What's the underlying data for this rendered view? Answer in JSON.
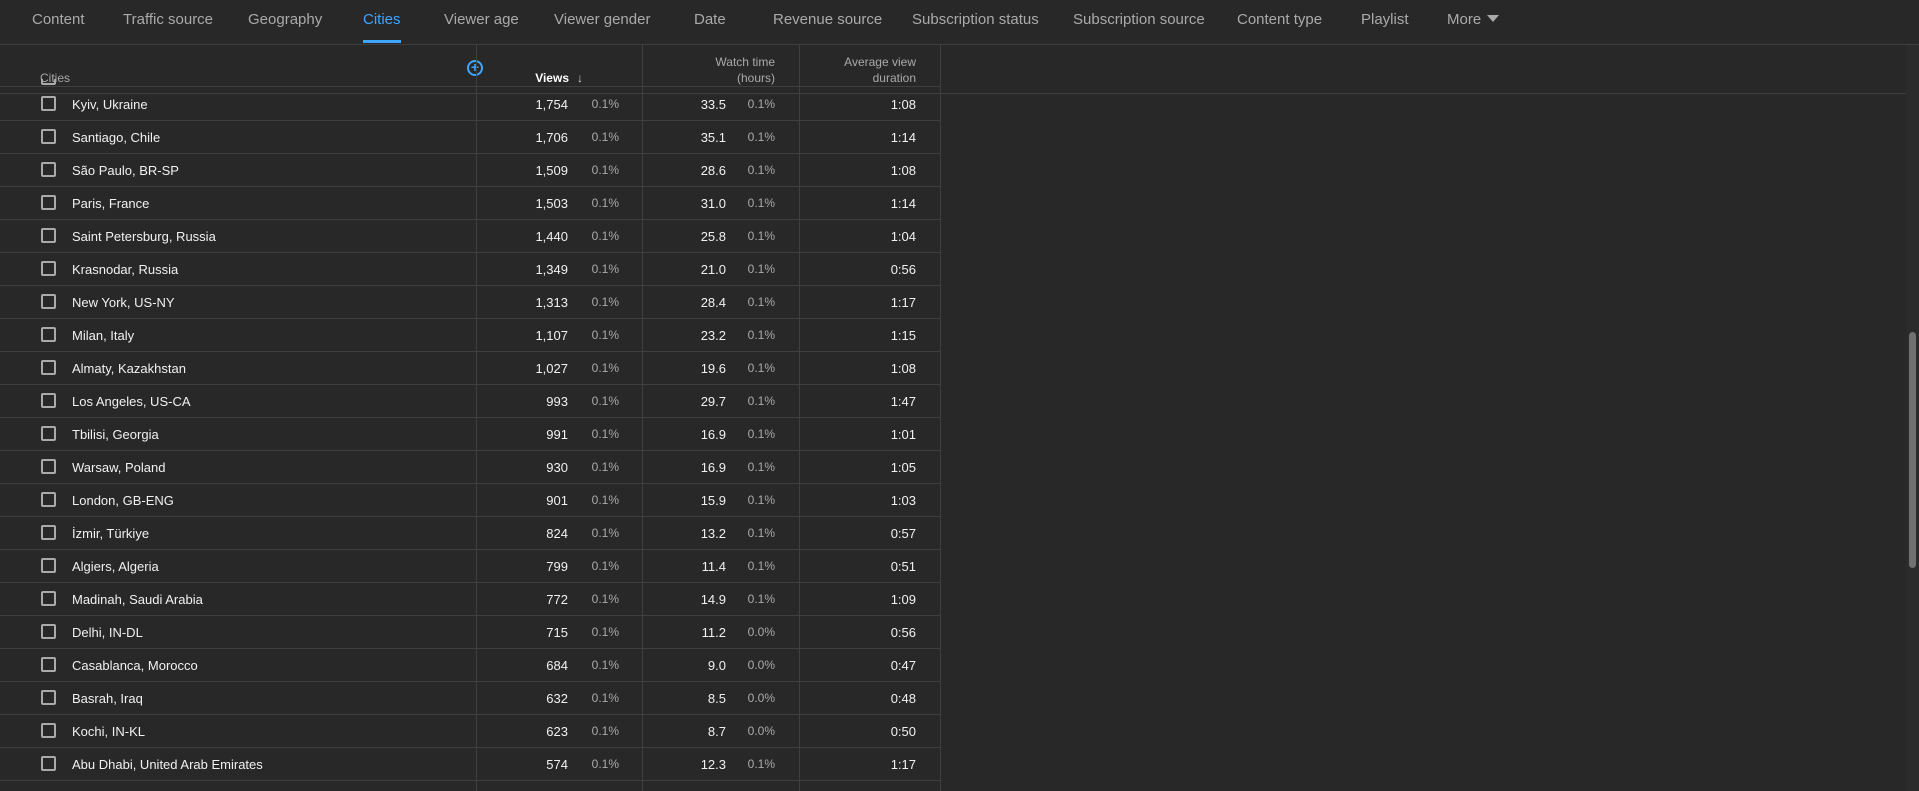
{
  "tabs": [
    {
      "label": "Content",
      "active": false
    },
    {
      "label": "Traffic source",
      "active": false
    },
    {
      "label": "Geography",
      "active": false
    },
    {
      "label": "Cities",
      "active": true
    },
    {
      "label": "Viewer age",
      "active": false
    },
    {
      "label": "Viewer gender",
      "active": false
    },
    {
      "label": "Date",
      "active": false
    },
    {
      "label": "Revenue source",
      "active": false
    },
    {
      "label": "Subscription status",
      "active": false
    },
    {
      "label": "Subscription source",
      "active": false
    },
    {
      "label": "Content type",
      "active": false
    },
    {
      "label": "Playlist",
      "active": false
    },
    {
      "label": "More",
      "active": false
    }
  ],
  "table": {
    "headers": {
      "cities": "Cities",
      "views": "Views",
      "views_sort_arrow": "↓",
      "watch_time_line1": "Watch time",
      "watch_time_line2": "(hours)",
      "avd_line1": "Average view",
      "avd_line2": "duration",
      "add_column_icon": "+"
    },
    "rows": [
      {
        "city": "Kyiv, Ukraine",
        "views": "1,754",
        "views_pct": "0.1%",
        "watch": "33.5",
        "watch_pct": "0.1%",
        "avd": "1:08"
      },
      {
        "city": "Santiago, Chile",
        "views": "1,706",
        "views_pct": "0.1%",
        "watch": "35.1",
        "watch_pct": "0.1%",
        "avd": "1:14"
      },
      {
        "city": "São Paulo, BR-SP",
        "views": "1,509",
        "views_pct": "0.1%",
        "watch": "28.6",
        "watch_pct": "0.1%",
        "avd": "1:08"
      },
      {
        "city": "Paris, France",
        "views": "1,503",
        "views_pct": "0.1%",
        "watch": "31.0",
        "watch_pct": "0.1%",
        "avd": "1:14"
      },
      {
        "city": "Saint Petersburg, Russia",
        "views": "1,440",
        "views_pct": "0.1%",
        "watch": "25.8",
        "watch_pct": "0.1%",
        "avd": "1:04"
      },
      {
        "city": "Krasnodar, Russia",
        "views": "1,349",
        "views_pct": "0.1%",
        "watch": "21.0",
        "watch_pct": "0.1%",
        "avd": "0:56"
      },
      {
        "city": "New York, US-NY",
        "views": "1,313",
        "views_pct": "0.1%",
        "watch": "28.4",
        "watch_pct": "0.1%",
        "avd": "1:17"
      },
      {
        "city": "Milan, Italy",
        "views": "1,107",
        "views_pct": "0.1%",
        "watch": "23.2",
        "watch_pct": "0.1%",
        "avd": "1:15"
      },
      {
        "city": "Almaty, Kazakhstan",
        "views": "1,027",
        "views_pct": "0.1%",
        "watch": "19.6",
        "watch_pct": "0.1%",
        "avd": "1:08"
      },
      {
        "city": "Los Angeles, US-CA",
        "views": "993",
        "views_pct": "0.1%",
        "watch": "29.7",
        "watch_pct": "0.1%",
        "avd": "1:47"
      },
      {
        "city": "Tbilisi, Georgia",
        "views": "991",
        "views_pct": "0.1%",
        "watch": "16.9",
        "watch_pct": "0.1%",
        "avd": "1:01"
      },
      {
        "city": "Warsaw, Poland",
        "views": "930",
        "views_pct": "0.1%",
        "watch": "16.9",
        "watch_pct": "0.1%",
        "avd": "1:05"
      },
      {
        "city": "London, GB-ENG",
        "views": "901",
        "views_pct": "0.1%",
        "watch": "15.9",
        "watch_pct": "0.1%",
        "avd": "1:03"
      },
      {
        "city": "İzmir, Türkiye",
        "views": "824",
        "views_pct": "0.1%",
        "watch": "13.2",
        "watch_pct": "0.1%",
        "avd": "0:57"
      },
      {
        "city": "Algiers, Algeria",
        "views": "799",
        "views_pct": "0.1%",
        "watch": "11.4",
        "watch_pct": "0.1%",
        "avd": "0:51"
      },
      {
        "city": "Madinah, Saudi Arabia",
        "views": "772",
        "views_pct": "0.1%",
        "watch": "14.9",
        "watch_pct": "0.1%",
        "avd": "1:09"
      },
      {
        "city": "Delhi, IN-DL",
        "views": "715",
        "views_pct": "0.1%",
        "watch": "11.2",
        "watch_pct": "0.0%",
        "avd": "0:56"
      },
      {
        "city": "Casablanca, Morocco",
        "views": "684",
        "views_pct": "0.1%",
        "watch": "9.0",
        "watch_pct": "0.0%",
        "avd": "0:47"
      },
      {
        "city": "Basrah, Iraq",
        "views": "632",
        "views_pct": "0.1%",
        "watch": "8.5",
        "watch_pct": "0.0%",
        "avd": "0:48"
      },
      {
        "city": "Kochi, IN-KL",
        "views": "623",
        "views_pct": "0.1%",
        "watch": "8.7",
        "watch_pct": "0.0%",
        "avd": "0:50"
      },
      {
        "city": "Abu Dhabi, United Arab Emirates",
        "views": "574",
        "views_pct": "0.1%",
        "watch": "12.3",
        "watch_pct": "0.1%",
        "avd": "1:17"
      }
    ]
  },
  "colors": {
    "background": "#282828",
    "accent": "#3ea6ff",
    "divider": "#3f3f3f",
    "muted_text": "#aaaaaa",
    "text": "#f1f1f1"
  },
  "icons": {
    "sort": "arrow-down-icon",
    "add_column": "plus-circle-icon",
    "more": "caret-down-icon",
    "row_select": "checkbox-icon"
  }
}
